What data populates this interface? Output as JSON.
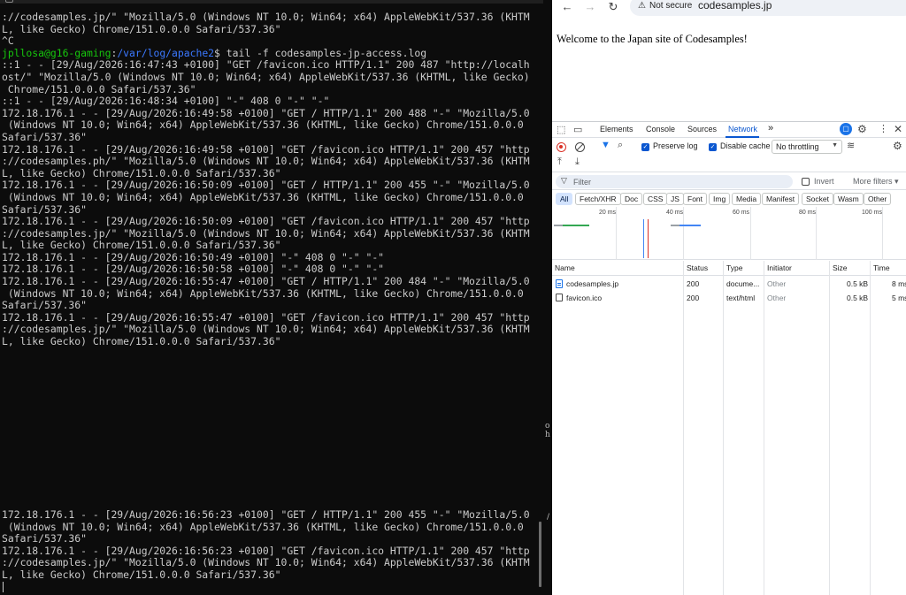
{
  "terminal": {
    "top_lines": [
      {
        "text": "://codesamples.jp/\" \"Mozilla/5.0 (Windows NT 10.0; Win64; x64) AppleWebKit/537.36 (KHTM"
      },
      {
        "text": "L, like Gecko) Chrome/151.0.0.0 Safari/537.36\""
      },
      {
        "text": "^C"
      },
      {
        "prompt_user": "jpllosa@g16-gaming",
        "prompt_sep": ":",
        "prompt_path": "/var/log/apache2",
        "prompt_cmd": "$ tail -f codesamples-jp-access.log"
      },
      {
        "text": "::1 - - [29/Aug/2026:16:47:43 +0100] \"GET /favicon.ico HTTP/1.1\" 200 487 \"http://localh"
      },
      {
        "text": "ost/\" \"Mozilla/5.0 (Windows NT 10.0; Win64; x64) AppleWebKit/537.36 (KHTML, like Gecko)"
      },
      {
        "text": " Chrome/151.0.0.0 Safari/537.36\""
      },
      {
        "text": "::1 - - [29/Aug/2026:16:48:34 +0100] \"-\" 408 0 \"-\" \"-\""
      },
      {
        "text": "172.18.176.1 - - [29/Aug/2026:16:49:58 +0100] \"GET / HTTP/1.1\" 200 488 \"-\" \"Mozilla/5.0"
      },
      {
        "text": " (Windows NT 10.0; Win64; x64) AppleWebKit/537.36 (KHTML, like Gecko) Chrome/151.0.0.0"
      },
      {
        "text": "Safari/537.36\""
      },
      {
        "text": "172.18.176.1 - - [29/Aug/2026:16:49:58 +0100] \"GET /favicon.ico HTTP/1.1\" 200 457 \"http"
      },
      {
        "text": "://codesamples.ph/\" \"Mozilla/5.0 (Windows NT 10.0; Win64; x64) AppleWebKit/537.36 (KHTM"
      },
      {
        "text": "L, like Gecko) Chrome/151.0.0.0 Safari/537.36\""
      },
      {
        "text": "172.18.176.1 - - [29/Aug/2026:16:50:09 +0100] \"GET / HTTP/1.1\" 200 455 \"-\" \"Mozilla/5.0"
      },
      {
        "text": " (Windows NT 10.0; Win64; x64) AppleWebKit/537.36 (KHTML, like Gecko) Chrome/151.0.0.0"
      },
      {
        "text": "Safari/537.36\""
      },
      {
        "text": "172.18.176.1 - - [29/Aug/2026:16:50:09 +0100] \"GET /favicon.ico HTTP/1.1\" 200 457 \"http"
      },
      {
        "text": "://codesamples.jp/\" \"Mozilla/5.0 (Windows NT 10.0; Win64; x64) AppleWebKit/537.36 (KHTM"
      },
      {
        "text": "L, like Gecko) Chrome/151.0.0.0 Safari/537.36\""
      },
      {
        "text": "172.18.176.1 - - [29/Aug/2026:16:50:49 +0100] \"-\" 408 0 \"-\" \"-\""
      },
      {
        "text": "172.18.176.1 - - [29/Aug/2026:16:50:58 +0100] \"-\" 408 0 \"-\" \"-\""
      },
      {
        "text": "172.18.176.1 - - [29/Aug/2026:16:55:47 +0100] \"GET / HTTP/1.1\" 200 484 \"-\" \"Mozilla/5.0"
      },
      {
        "text": " (Windows NT 10.0; Win64; x64) AppleWebKit/537.36 (KHTML, like Gecko) Chrome/151.0.0.0"
      },
      {
        "text": "Safari/537.36\""
      },
      {
        "text": "172.18.176.1 - - [29/Aug/2026:16:55:47 +0100] \"GET /favicon.ico HTTP/1.1\" 200 457 \"http"
      },
      {
        "text": "://codesamples.jp/\" \"Mozilla/5.0 (Windows NT 10.0; Win64; x64) AppleWebKit/537.36 (KHTM"
      },
      {
        "text": "L, like Gecko) Chrome/151.0.0.0 Safari/537.36\""
      }
    ],
    "bottom_lines": [
      {
        "text": "172.18.176.1 - - [29/Aug/2026:16:56:23 +0100] \"GET / HTTP/1.1\" 200 455 \"-\" \"Mozilla/5.0"
      },
      {
        "text": " (Windows NT 10.0; Win64; x64) AppleWebKit/537.36 (KHTML, like Gecko) Chrome/151.0.0.0"
      },
      {
        "text": "Safari/537.36\""
      },
      {
        "text": "172.18.176.1 - - [29/Aug/2026:16:56:23 +0100] \"GET /favicon.ico HTTP/1.1\" 200 457 \"http"
      },
      {
        "text": "://codesamples.jp/\" \"Mozilla/5.0 (Windows NT 10.0; Win64; x64) AppleWebKit/537.36 (KHTM"
      },
      {
        "text": "L, like Gecko) Chrome/151.0.0.0 Safari/537.36\""
      }
    ],
    "colors": {
      "background": "#0c0c0c",
      "text": "#cccccc",
      "user": "#16c60c",
      "path": "#3b78ff"
    }
  },
  "divider": {
    "fragment_1": "o\nh",
    "fragment_2": "/"
  },
  "browser": {
    "nav": {
      "back_icon": "arrow-left-icon",
      "forward_icon": "arrow-right-icon",
      "reload_icon": "reload-icon"
    },
    "omnibox": {
      "security_icon": "warning-triangle-icon",
      "security_label": "Not secure",
      "url": "codesamples.jp"
    },
    "page": {
      "welcome_text": "Welcome to the Japan site of Codesamples!"
    },
    "devtools": {
      "tabs": [
        "Elements",
        "Console",
        "Sources",
        "Network"
      ],
      "active_tab": "Network",
      "more_tabs_label": "»",
      "toolbar": {
        "preserve_log_label": "Preserve log",
        "preserve_log_checked": true,
        "disable_cache_label": "Disable cache",
        "disable_cache_checked": true,
        "throttling_value": "No throttling"
      },
      "filter": {
        "placeholder": "Filter",
        "invert_label": "Invert",
        "more_filters_label": "More filters ▾"
      },
      "type_chips": [
        "All",
        "Fetch/XHR",
        "Doc",
        "CSS",
        "JS",
        "Font",
        "Img",
        "Media",
        "Manifest",
        "Socket",
        "Wasm",
        "Other"
      ],
      "active_chip": "All",
      "timeline_labels": [
        "20 ms",
        "40 ms",
        "60 ms",
        "80 ms",
        "100 ms"
      ],
      "columns": [
        "Name",
        "Status",
        "Type",
        "Initiator",
        "Size",
        "Time"
      ],
      "rows": [
        {
          "name": "codesamples.jp",
          "icon": "document-icon",
          "status": "200",
          "type": "docume...",
          "initiator": "Other",
          "size": "0.5 kB",
          "time": "8 ms"
        },
        {
          "name": "favicon.ico",
          "icon": "file-icon",
          "status": "200",
          "type": "text/html",
          "initiator": "Other",
          "size": "0.5 kB",
          "time": "5 ms"
        }
      ],
      "colors": {
        "accent": "#0b57d0",
        "record": "#d93025",
        "chip_active_bg": "#d3e3fd"
      }
    }
  }
}
